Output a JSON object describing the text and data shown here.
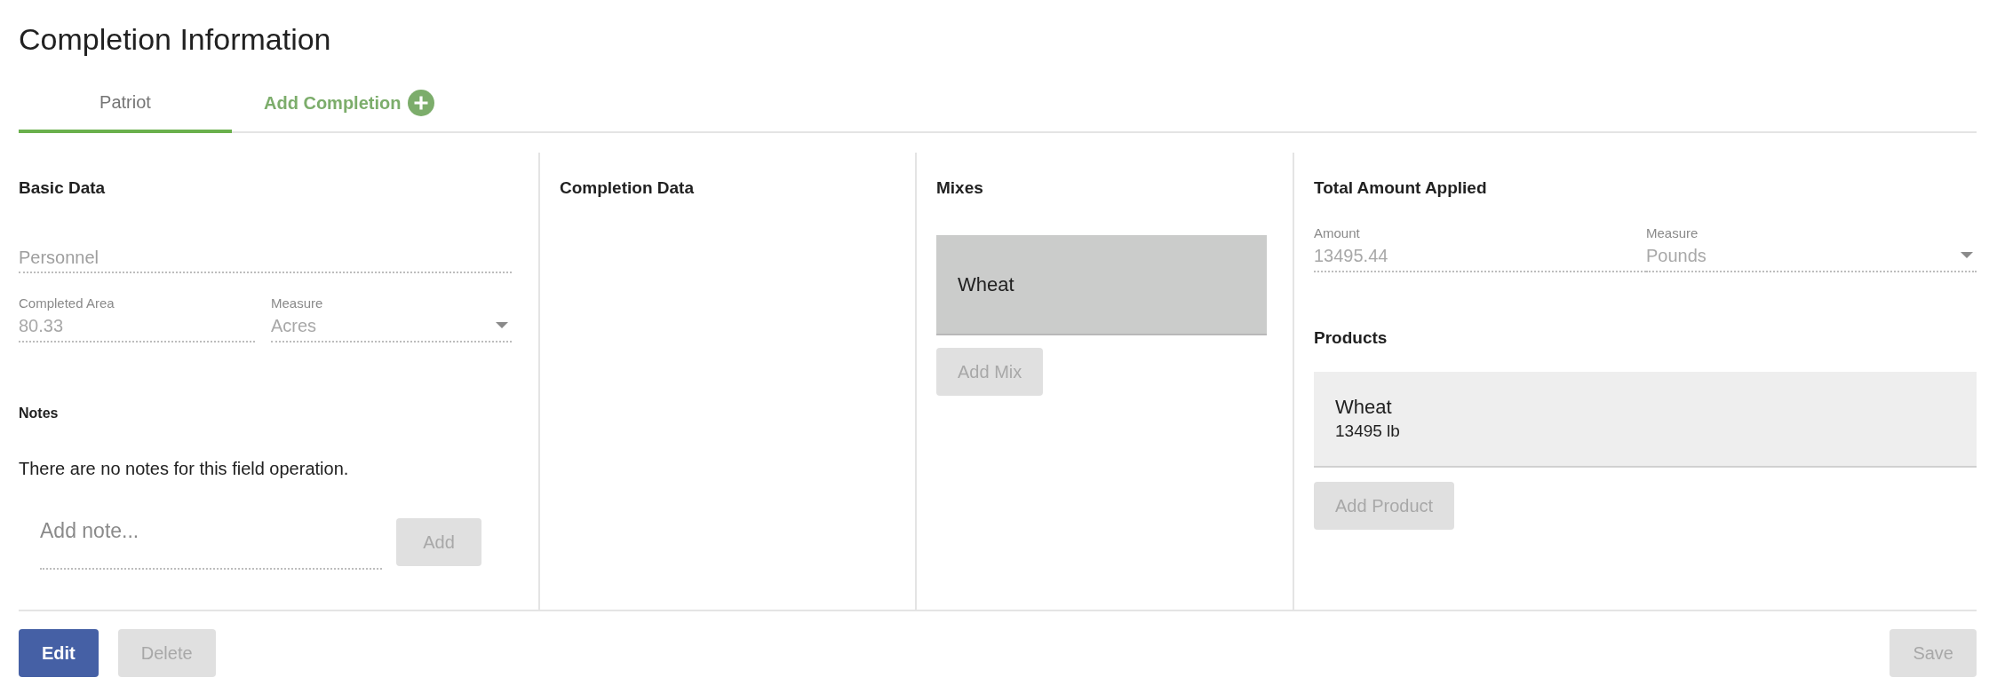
{
  "title": "Completion Information",
  "tabs": [
    {
      "label": "Patriot",
      "selected": true
    }
  ],
  "add_completion": {
    "label": "Add Completion"
  },
  "basic_data": {
    "heading": "Basic Data",
    "personnel": {
      "label": "Personnel"
    },
    "completed_area": {
      "label": "Completed Area",
      "value": "80.33"
    },
    "measure": {
      "label": "Measure",
      "value": "Acres"
    },
    "notes_heading": "Notes",
    "notes_empty": "There are no notes for this field operation.",
    "note_input": {
      "placeholder": "Add note..."
    },
    "add_button": {
      "label": "Add",
      "disabled": true
    }
  },
  "completion_data": {
    "heading": "Completion Data"
  },
  "mixes": {
    "heading": "Mixes",
    "items": [
      {
        "name": "Wheat",
        "selected": true
      }
    ],
    "add_button": {
      "label": "Add Mix",
      "disabled": true
    }
  },
  "total_amount": {
    "heading": "Total Amount Applied",
    "amount": {
      "label": "Amount",
      "value": "13495.44"
    },
    "measure": {
      "label": "Measure",
      "value": "Pounds"
    },
    "products_heading": "Products",
    "products": [
      {
        "name": "Wheat",
        "amount": "13495 lb",
        "selected": false
      }
    ],
    "add_button": {
      "label": "Add Product",
      "disabled": true
    }
  },
  "footer": {
    "left_buttons": [
      {
        "label": "Edit",
        "disabled": false
      },
      {
        "label": "Delete",
        "disabled": true
      }
    ],
    "right_buttons": [
      {
        "label": "Save",
        "disabled": true
      }
    ]
  }
}
